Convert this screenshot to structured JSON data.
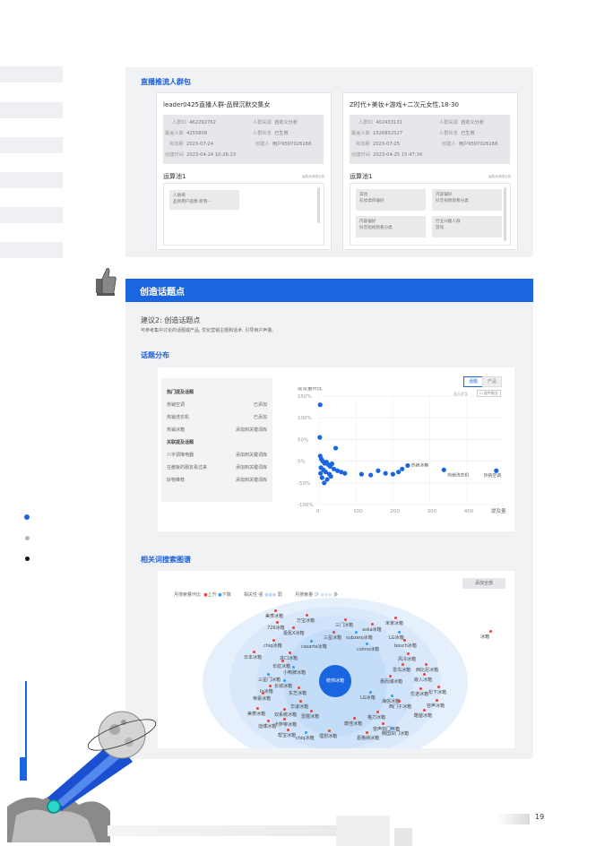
{
  "colors": {
    "accent": "#1a66e0",
    "rise": "#e0483a",
    "fall": "#3c9be8",
    "panel": "#f1f2f4"
  },
  "live_pack": {
    "title": "直播推流人群包",
    "cards": [
      {
        "title": "leader0425直播人群-品牌沉默交集女",
        "info": [
          {
            "k": "人群ID",
            "v": "462292762"
          },
          {
            "k": "人群来源",
            "v": "自定义分析"
          },
          {
            "k": "覆盖人数",
            "v": "4255809"
          },
          {
            "k": "人群状态",
            "v": "已生效"
          },
          {
            "k": "有效期",
            "v": "2023-07-24"
          },
          {
            "k": "创建人",
            "v": "用户9597026168"
          },
          {
            "k": "创建时间",
            "v": "2023-04-24 10:26:23"
          }
        ],
        "pool": "运算池1",
        "pool_note": "运算池说明文档",
        "chips": [
          {
            "title": "人群来",
            "sub": "品牌用户画像·新用···"
          }
        ]
      },
      {
        "title": "Z时代+美妆+游戏+二次元女性,18-30",
        "info": [
          {
            "k": "人群ID",
            "v": "402433131"
          },
          {
            "k": "人群来源",
            "v": "自定义分析"
          },
          {
            "k": "覆盖人数",
            "v": "1526852527"
          },
          {
            "k": "人群状态",
            "v": "已生效"
          },
          {
            "k": "有效期",
            "v": "2023-07-25"
          },
          {
            "k": "创建人",
            "v": "用户9597026168"
          },
          {
            "k": "创建时间",
            "v": "2023-04-25 15:47:34"
          }
        ],
        "pool": "运算池1",
        "pool_note": "运算池说明文档",
        "chips": [
          {
            "title": "美妆",
            "sub": "彩妆类目偏好"
          },
          {
            "title": "内容偏好",
            "sub": "抖音视频观看分类"
          },
          {
            "title": "内容偏好",
            "sub": "抖音短视频看分类"
          },
          {
            "title": "行业兴趣人群",
            "sub": "游戏"
          }
        ]
      }
    ]
  },
  "banner": {
    "title": "创造话题点"
  },
  "suggestion": {
    "title": "建议2: 创造话题点",
    "desc": "可参考集中讨论的话题或产品, 优化营销主题和话术, 引导用户声量。"
  },
  "topic_dist": {
    "title": "话题分布",
    "tabs": [
      "话题",
      "产品"
    ],
    "mini_btns": [
      "显示文字",
      "选中前方"
    ],
    "left_list": [
      {
        "name": "热门提及话题",
        "action": "",
        "header": true
      },
      {
        "name": "热销空调",
        "action": "已添加"
      },
      {
        "name": "热销洗衣机",
        "action": "已添加"
      },
      {
        "name": "热销冰箱",
        "action": "添加到关键词库"
      },
      {
        "name": "关联提及话题",
        "action": "",
        "header": true
      },
      {
        "name": "八字调降电器",
        "action": "添加到关键词库"
      },
      {
        "name": "在酱板的朋友看过来",
        "action": "添加到关键词库"
      },
      {
        "name": "好物推荐",
        "action": "添加到关键词库"
      }
    ]
  },
  "chart_data": {
    "type": "scatter",
    "title": "",
    "ylabel": "提及量环比",
    "xlabel": "提及量",
    "xlim": [
      0,
      500
    ],
    "ylim": [
      -100,
      150
    ],
    "x_ticks": [
      "0",
      "100",
      "200",
      "300",
      "400"
    ],
    "y_ticks": [
      "150%",
      "100%",
      "50%",
      "0%",
      "-50%",
      "-100%"
    ],
    "points": [
      {
        "x": 3,
        "y": 130
      },
      {
        "x": 2,
        "y": 55
      },
      {
        "x": 45,
        "y": 30
      },
      {
        "x": 3,
        "y": 12
      },
      {
        "x": 6,
        "y": 5
      },
      {
        "x": 10,
        "y": 0
      },
      {
        "x": 15,
        "y": -5
      },
      {
        "x": 20,
        "y": -2
      },
      {
        "x": 25,
        "y": -8
      },
      {
        "x": 30,
        "y": -12
      },
      {
        "x": 35,
        "y": -6
      },
      {
        "x": 5,
        "y": -15
      },
      {
        "x": 12,
        "y": -20
      },
      {
        "x": 18,
        "y": -25
      },
      {
        "x": 28,
        "y": -30
      },
      {
        "x": 8,
        "y": -38
      },
      {
        "x": 22,
        "y": -42
      },
      {
        "x": 14,
        "y": -50
      },
      {
        "x": 40,
        "y": -18
      },
      {
        "x": 4,
        "y": -28
      },
      {
        "x": 32,
        "y": -35
      },
      {
        "x": 50,
        "y": -22
      },
      {
        "x": 60,
        "y": -25
      },
      {
        "x": 70,
        "y": -28
      },
      {
        "x": 115,
        "y": -30
      },
      {
        "x": 140,
        "y": -32
      },
      {
        "x": 160,
        "y": -22
      },
      {
        "x": 180,
        "y": -28
      },
      {
        "x": 200,
        "y": -30
      },
      {
        "x": 215,
        "y": -25
      },
      {
        "x": 225,
        "y": -18
      },
      {
        "x": 240,
        "y": -10
      },
      {
        "x": 338,
        "y": -20
      },
      {
        "x": 480,
        "y": -22
      }
    ],
    "labels": [
      {
        "x": 240,
        "y": -10,
        "text": "热销冰箱"
      },
      {
        "x": 338,
        "y": -20,
        "text": "热销洗衣机"
      },
      {
        "x": 480,
        "y": -22,
        "text": "热销空调"
      }
    ]
  },
  "related": {
    "title": "相关词搜索图谱",
    "add_all": "添加全部",
    "legend": {
      "trend": "月搜索量环比",
      "up": "上升",
      "down": "下降",
      "relevance": "相关性",
      "strong": "强",
      "weak": "弱",
      "volume": "月搜索量",
      "less": "少",
      "more": "多"
    },
    "center": "统帅冰箱",
    "keywords": [
      {
        "t": "美菱冰箱",
        "c": "up"
      },
      {
        "t": "726冰箱",
        "c": "up"
      },
      {
        "t": "万宝冰箱",
        "c": "up"
      },
      {
        "t": "三门冰箱",
        "c": "up"
      },
      {
        "t": "米家冰箱",
        "c": "up"
      },
      {
        "t": "极氪X冰箱",
        "c": "up"
      },
      {
        "t": "三星冰箱",
        "c": "up"
      },
      {
        "t": "subzero冰箱",
        "c": "down"
      },
      {
        "t": "aska冰箱",
        "c": "up"
      },
      {
        "t": "LG冰箱",
        "c": "down"
      },
      {
        "t": "chiq冰箱",
        "c": "up"
      },
      {
        "t": "casarte冰箱",
        "c": "down"
      },
      {
        "t": "colmo冰箱",
        "c": "down"
      },
      {
        "t": "bosch冰箱",
        "c": "up"
      },
      {
        "t": "冰箱",
        "c": "up"
      },
      {
        "t": "日本冰箱",
        "c": "up"
      },
      {
        "t": "进口冰箱",
        "c": "up"
      },
      {
        "t": "长虹冰箱",
        "c": "up"
      },
      {
        "t": "风冷冰箱",
        "c": "up"
      },
      {
        "t": "小鸭牌冰箱",
        "c": "down"
      },
      {
        "t": "雷鸟冰箱",
        "c": "up"
      },
      {
        "t": "西比尼冰箱",
        "c": "up"
      },
      {
        "t": "三星门冰箱",
        "c": "down"
      },
      {
        "t": "惠而浦冰箱",
        "c": "up"
      },
      {
        "t": "嵌入冰箱",
        "c": "up"
      },
      {
        "t": "lg冰箱",
        "c": "up"
      },
      {
        "t": "东芝冰箱",
        "c": "up"
      },
      {
        "t": "长城冰箱",
        "c": "down"
      },
      {
        "t": "海信冰箱",
        "c": "down"
      },
      {
        "t": "松下冰箱",
        "c": "up"
      },
      {
        "t": "帝豪冰箱",
        "c": "up"
      },
      {
        "t": "优诺冰箱",
        "c": "up"
      },
      {
        "t": "容声冰箱",
        "c": "up"
      },
      {
        "t": "LG冰箱",
        "c": "down"
      },
      {
        "t": "西门子冰箱",
        "c": "up"
      },
      {
        "t": "双系统冰箱",
        "c": "up"
      },
      {
        "t": "华凌冰箱",
        "c": "up"
      },
      {
        "t": "美菱冰箱",
        "c": "up"
      },
      {
        "t": "酷爸冰箱",
        "c": "up"
      },
      {
        "t": "卡萨帝冰箱",
        "c": "up"
      },
      {
        "t": "雷霆冰箱",
        "c": "up"
      },
      {
        "t": "康佳冰箱",
        "c": "up"
      },
      {
        "t": "格力冰箱",
        "c": "up"
      },
      {
        "t": "容声双门冰箱",
        "c": "up"
      },
      {
        "t": "韩国双门冰箱",
        "c": "down"
      },
      {
        "t": "迪博冰箱",
        "c": "up"
      },
      {
        "t": "帮宝冰箱",
        "c": "up"
      },
      {
        "t": "chiq冰箱",
        "c": "down"
      },
      {
        "t": "理想冰箱",
        "c": "up"
      },
      {
        "t": "嘉格纳冰箱",
        "c": "up"
      }
    ]
  },
  "page_number": "19"
}
